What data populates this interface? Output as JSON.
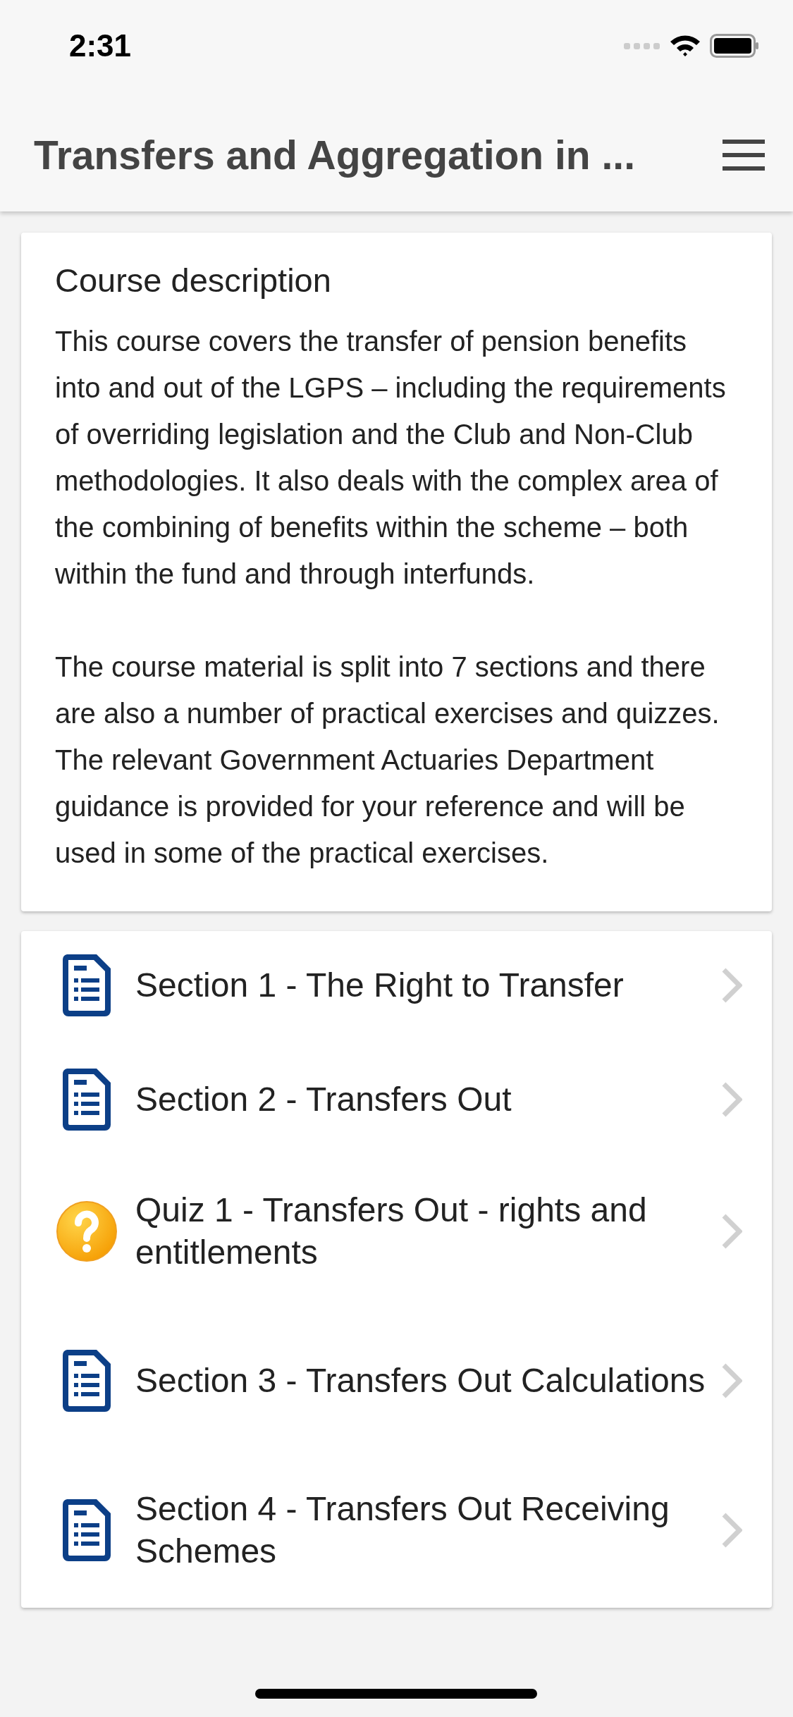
{
  "status_bar": {
    "time": "2:31"
  },
  "header": {
    "title": "Transfers and Aggregation in ..."
  },
  "description": {
    "heading": "Course description",
    "paragraphs": [
      "This course covers the transfer of pension benefits into and out of the LGPS – including the requirements of overriding legislation and the Club and Non-Club methodologies. It also deals with the complex area of the combining of benefits within the scheme – both within the fund and through interfunds.",
      "The course material is split into 7 sections and there are also a number of practical exercises and quizzes. The relevant Government Actuaries Department guidance is provided for your reference and will be used in some of the practical exercises."
    ]
  },
  "items": [
    {
      "kind": "section",
      "label": "Section 1 - The Right to Transfer"
    },
    {
      "kind": "section",
      "label": "Section 2 - Transfers Out"
    },
    {
      "kind": "quiz",
      "label": "Quiz 1 - Transfers Out - rights and entitlements"
    },
    {
      "kind": "section",
      "label": "Section 3 - Transfers Out Calculations"
    },
    {
      "kind": "section",
      "label": "Section 4 - Transfers Out Receiving Schemes"
    }
  ]
}
